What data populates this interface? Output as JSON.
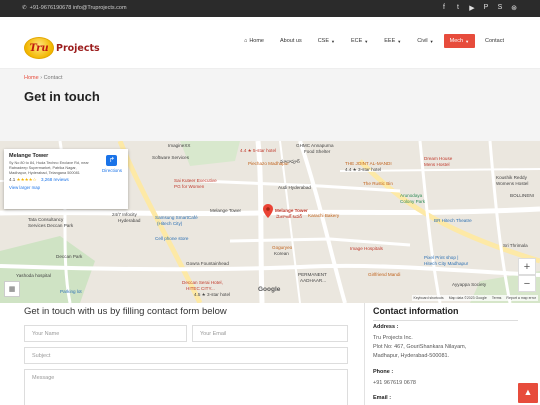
{
  "topbar": {
    "contact": "+91-9676190678 info@Truprojects.com",
    "social_icons": [
      "facebook-icon",
      "twitter-icon",
      "youtube-icon",
      "pinterest-icon",
      "skype-icon",
      "dribbble-icon"
    ]
  },
  "logo": {
    "badge": "Tru",
    "text": "Projects"
  },
  "nav": {
    "items": [
      {
        "label": "Home",
        "icon": "home-icon"
      },
      {
        "label": "About us"
      },
      {
        "label": "CSE"
      },
      {
        "label": "ECE"
      },
      {
        "label": "EEE"
      },
      {
        "label": "Civil"
      },
      {
        "label": "Mech"
      },
      {
        "label": "Contact"
      }
    ],
    "active_color": "#e74c3c"
  },
  "breadcrumb": {
    "home": "Home",
    "separator": "›",
    "current": "Contact"
  },
  "page_title": "Get in touch",
  "map": {
    "place_name": "Melange Tower",
    "place_address": "Sy No 80 to 84, Huda Techno Enclave Rd, near Ratnadeep Supermarket, Patrika Nagar, Madhapur, Hyderabad, Telangana 500081",
    "rating": "4.1",
    "stars": "★★★★☆",
    "reviews": "3,268 reviews",
    "larger_map": "View larger map",
    "directions": "Directions",
    "pin_label": "Melange Tower",
    "pin_label_local": "మెలాంజ్ టవర్",
    "zoom_in": "+",
    "zoom_out": "−",
    "google": "Google",
    "attribution": [
      "Keyboard shortcuts",
      "Map data ©2023 Google",
      "Terms",
      "Report a map error"
    ],
    "labels": {
      "imagineit": "ImagineXX",
      "software_services": "Software Services",
      "madhapur_local": "మాదాపూర్",
      "piechazo": "Piechazo Madhapur",
      "ghmc": "GHMC Annapurna",
      "food_shelter": "Food Shelter",
      "joint_al_mandi": "THE JOINT AL-MANDI",
      "dream_house": "Dream House",
      "mens_hostel": "Mens Hostel",
      "kushik_reddy": "Koushik Reddy",
      "womens_hostel": "Womens Hostel",
      "sai_kuteer": "Sai Kuteer Executive",
      "pg_for_women": "PG for Women",
      "audi": "Audi Hyderabad",
      "rustic_bin": "The Rustic Bin",
      "arunodaya": "Arunodaya",
      "colony_park": "Colony Park",
      "bollineni": "BOLLINENI",
      "tata": "Tata Consultancy",
      "deccan_park_services": "Services Deccan Park",
      "hours": "24/7 Infocity",
      "hyderabad": "Hyderabad",
      "samsung": "Samsung SmartCafé",
      "hitech_city": "(Hitech City)",
      "melange_left": "Melange Tower",
      "karachi": "Karachi Bakery",
      "bh_theatre": "BR Hitech Theatre",
      "deccan_park": "Deccan Park",
      "cell_phone": "Cell phone store",
      "gowra": "Gowra Fountainhead",
      "goguryeo": "Goguryeo",
      "korean": "Korean",
      "imagehospitals": "Image Hospitals",
      "sri_thirumala": "Sri Thrimala",
      "pixel": "Pixel Print shop |",
      "hitech_printing": "Hitech City Madhapur",
      "permanent": "PERMANENT",
      "aadhaar": "AADHAAR...",
      "girlfriend": "Girlfriend Mandi",
      "yashoda": "Yashoda hospital",
      "parking": "Parking lot",
      "deccan_serai": "Deccan Serai Hotel,",
      "hitec_city_caps": "HITEC CITY...",
      "hotel_4_5": "4.5 ★ 3-star hotel",
      "hotel_4_4": "4.4 ★ 5-star hotel",
      "hotel_4_4b": "4.4 ★ 3-star hotel",
      "ayyappa_society": "Ayyappa Society"
    }
  },
  "form": {
    "title": "Get in touch with us by filling contact form below",
    "name_placeholder": "Your Name",
    "email_placeholder": "Your Email",
    "subject_placeholder": "Subject",
    "message_placeholder": "Message"
  },
  "contact_info": {
    "title": "Contact information",
    "address_label": "Address :",
    "company": "Tru Projects Inc.",
    "address_line1": "Plot No: 467, GouriShankara Nilayam,",
    "address_line2": "Madhapur, Hyderabad-500081.",
    "phone_label": "Phone :",
    "phone": "+91 967619 0678",
    "email_label": "Email :"
  },
  "scroll_top": "▲"
}
